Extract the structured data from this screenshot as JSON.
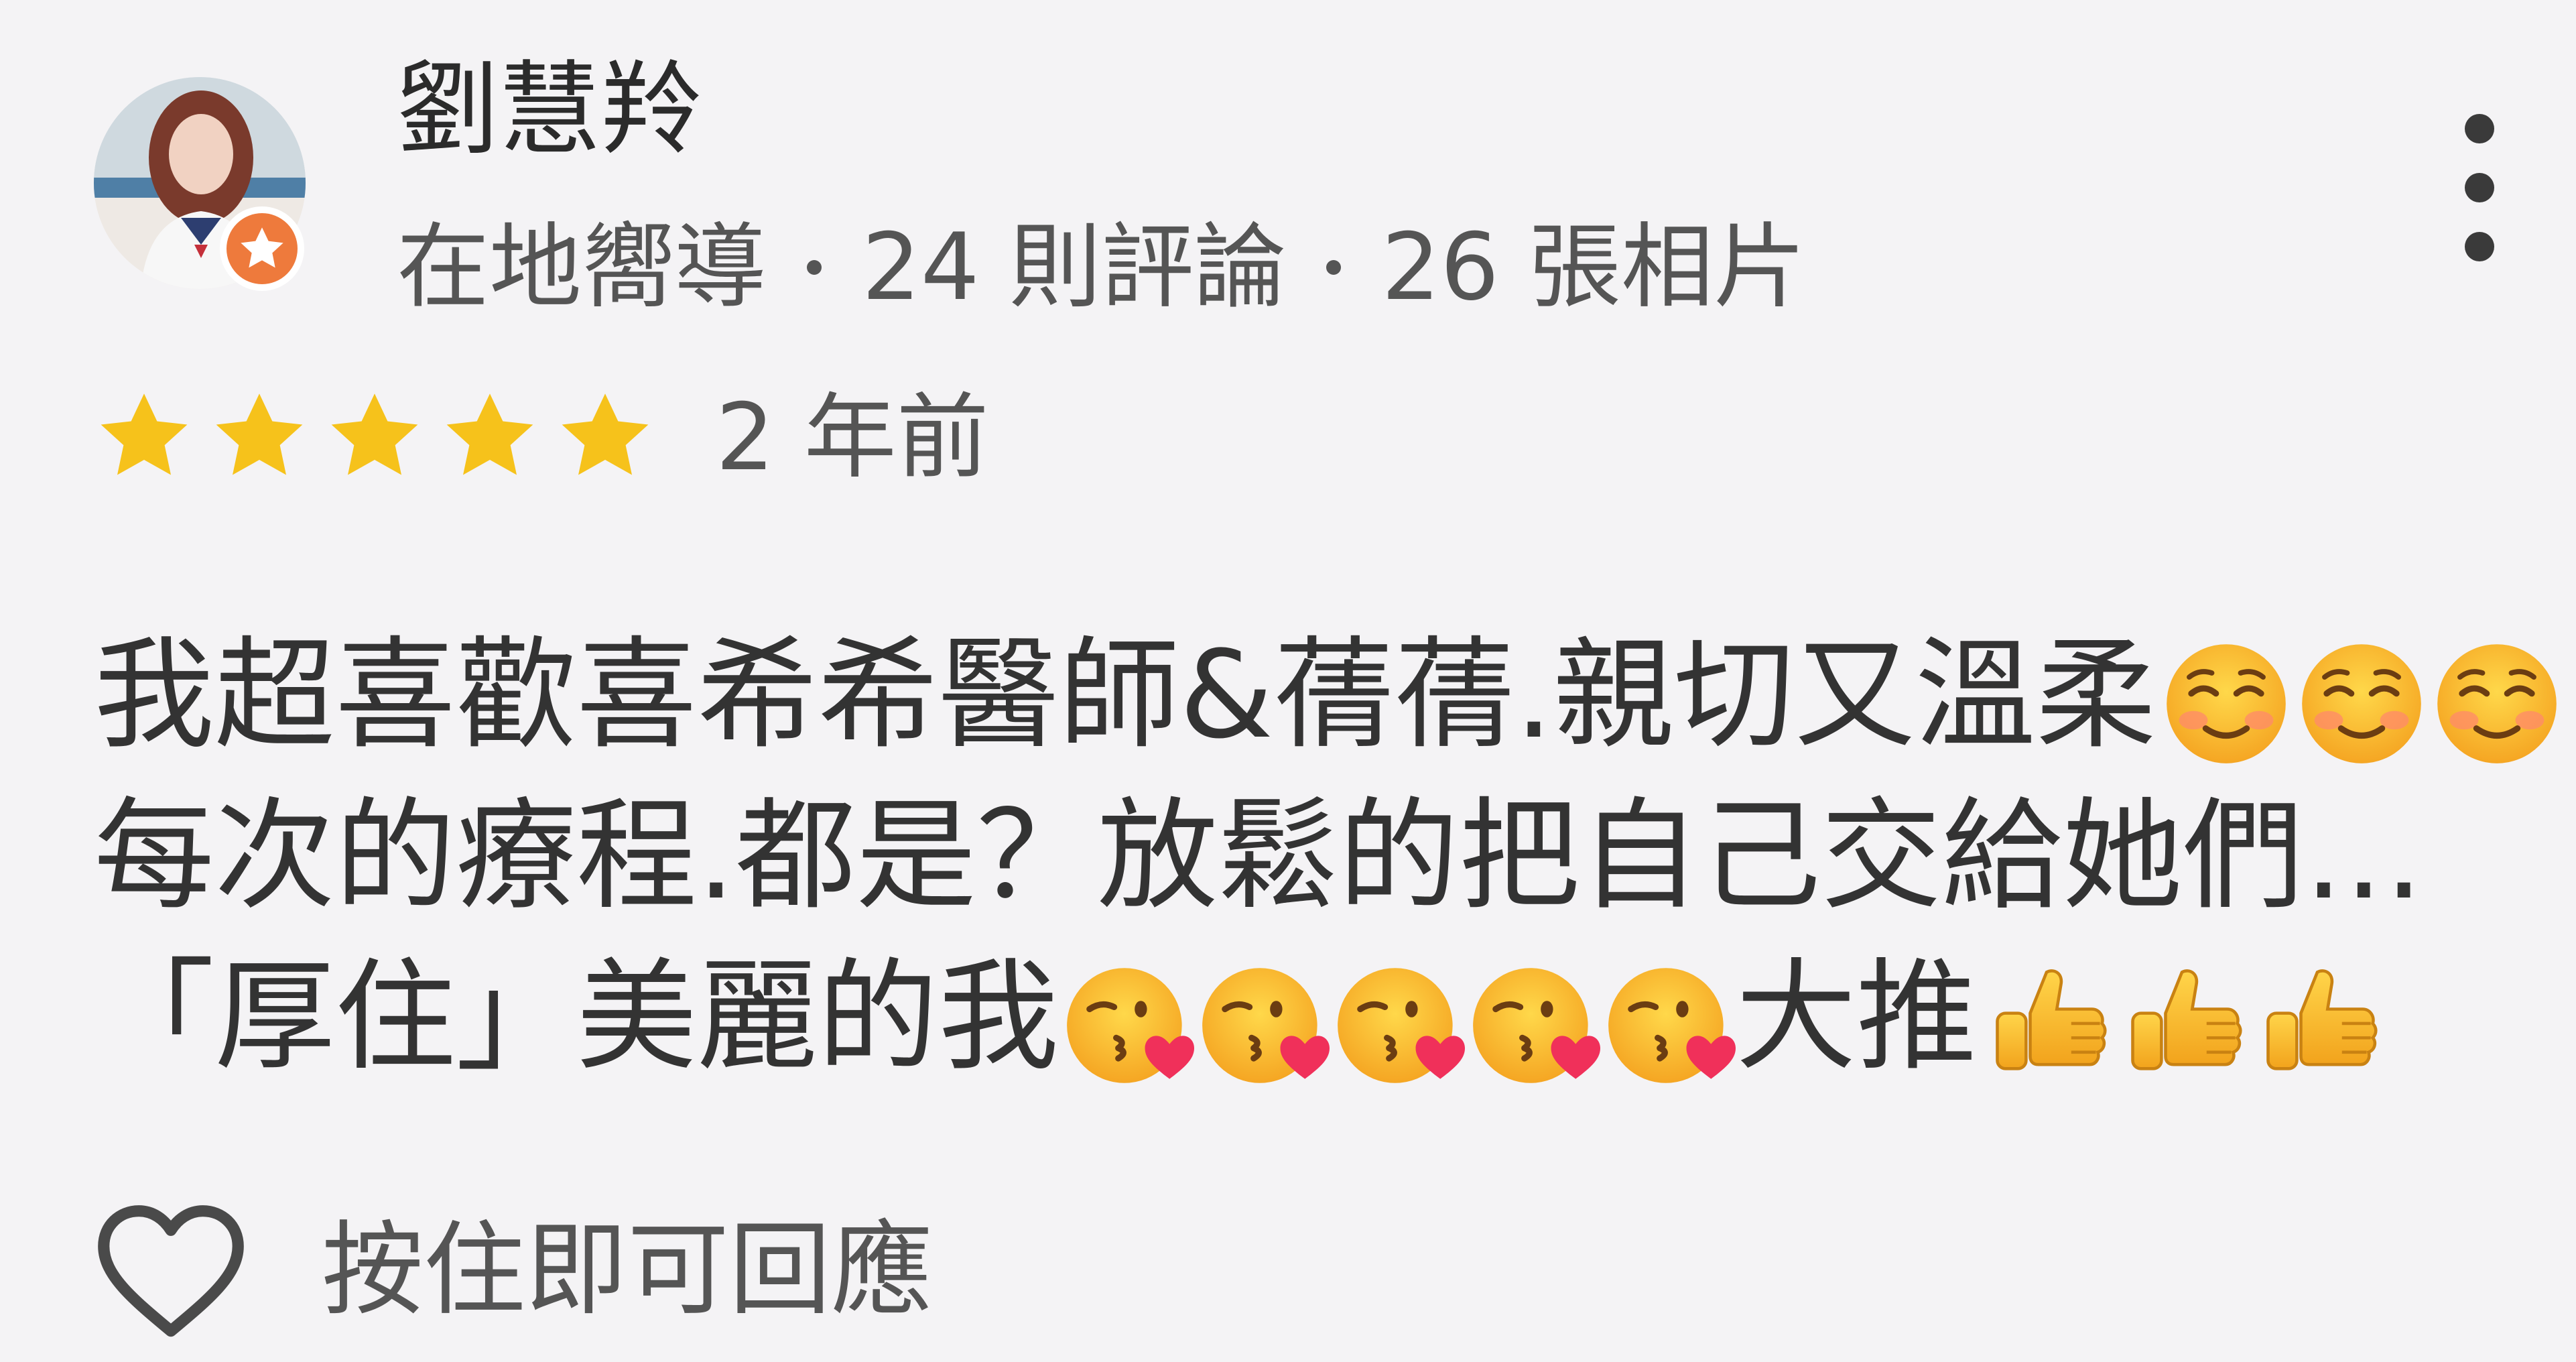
{
  "review": {
    "user": {
      "name": "劉慧羚",
      "role": "在地嚮導",
      "reviews_count": "24 則評論",
      "photos_count": "26 張相片",
      "badge_icon": "local-guide-star-icon"
    },
    "rating": {
      "stars": 5,
      "max": 5
    },
    "time_ago": "2 年前",
    "body": {
      "line1_text": "我超喜歡喜希希醫師&蒨蒨.親切又溫柔",
      "line1_emoji": [
        "smiling-blush-icon",
        "smiling-blush-icon",
        "smiling-blush-icon"
      ],
      "line2_text": "每次的療程.都是？放鬆的把自己交給她們…",
      "line3_text": "「厚住」美麗的我",
      "line3_emoji": [
        "kissing-heart-icon",
        "kissing-heart-icon",
        "kissing-heart-icon",
        "kissing-heart-icon",
        "kissing-heart-icon"
      ],
      "line3_tail": "大推",
      "line3_tail_emoji": [
        "thumbs-up-icon",
        "thumbs-up-icon",
        "thumbs-up-icon"
      ]
    },
    "reply_hint": "按住即可回應"
  },
  "colors": {
    "background": "#f4f3f5",
    "star": "#f6c21b",
    "badge": "#ee7a3c",
    "text_primary": "#2b2b2b",
    "text_secondary": "#555555"
  }
}
